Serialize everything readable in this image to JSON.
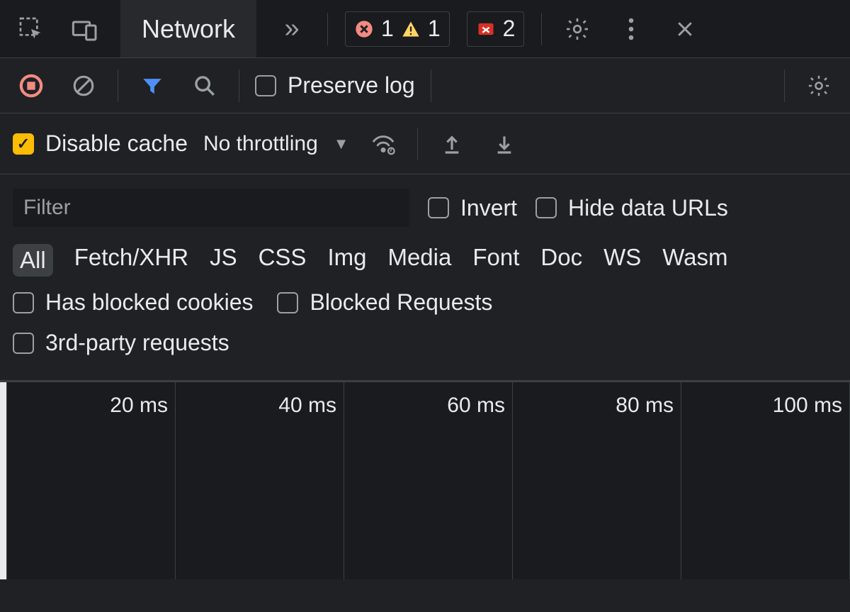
{
  "tabs": {
    "active_label": "Network"
  },
  "status": {
    "errors": "1",
    "warnings": "1",
    "issues": "2"
  },
  "toolbar": {
    "preserve_log_label": "Preserve log",
    "disable_cache_label": "Disable cache",
    "disable_cache_checked": true,
    "throttling_label": "No throttling"
  },
  "filter": {
    "placeholder": "Filter",
    "invert_label": "Invert",
    "hide_data_urls_label": "Hide data URLs",
    "types": [
      "All",
      "Fetch/XHR",
      "JS",
      "CSS",
      "Img",
      "Media",
      "Font",
      "Doc",
      "WS",
      "Wasm"
    ],
    "type_active_index": 0,
    "has_blocked_cookies_label": "Has blocked cookies",
    "blocked_requests_label": "Blocked Requests",
    "third_party_label": "3rd-party requests"
  },
  "timeline": {
    "ticks": [
      "20 ms",
      "40 ms",
      "60 ms",
      "80 ms",
      "100 ms"
    ]
  }
}
